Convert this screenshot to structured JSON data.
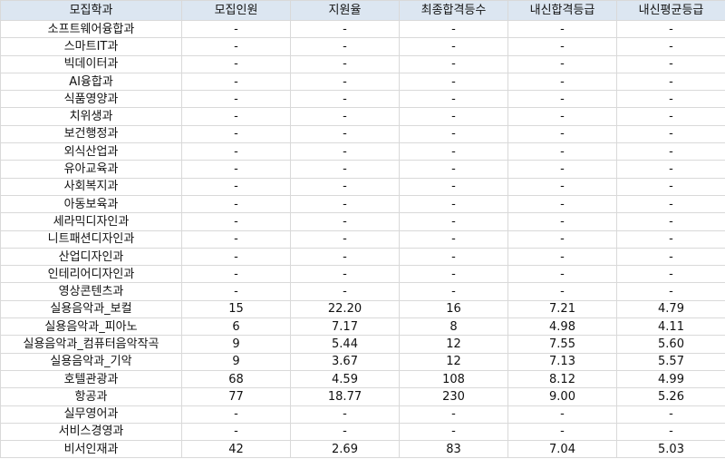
{
  "table": {
    "headers": [
      "모집학과",
      "모집인원",
      "지원율",
      "최종합격등수",
      "내신합격등급",
      "내신평균등급"
    ],
    "rows": [
      [
        "소프트웨어융합과",
        "-",
        "-",
        "-",
        "-",
        "-"
      ],
      [
        "스마트IT과",
        "-",
        "-",
        "-",
        "-",
        "-"
      ],
      [
        "빅데이터과",
        "-",
        "-",
        "-",
        "-",
        "-"
      ],
      [
        "AI융합과",
        "-",
        "-",
        "-",
        "-",
        "-"
      ],
      [
        "식품영양과",
        "-",
        "-",
        "-",
        "-",
        "-"
      ],
      [
        "치위생과",
        "-",
        "-",
        "-",
        "-",
        "-"
      ],
      [
        "보건행정과",
        "-",
        "-",
        "-",
        "-",
        "-"
      ],
      [
        "외식산업과",
        "-",
        "-",
        "-",
        "-",
        "-"
      ],
      [
        "유아교육과",
        "-",
        "-",
        "-",
        "-",
        "-"
      ],
      [
        "사회복지과",
        "-",
        "-",
        "-",
        "-",
        "-"
      ],
      [
        "아동보육과",
        "-",
        "-",
        "-",
        "-",
        "-"
      ],
      [
        "세라믹디자인과",
        "-",
        "-",
        "-",
        "-",
        "-"
      ],
      [
        "니트패션디자인과",
        "-",
        "-",
        "-",
        "-",
        "-"
      ],
      [
        "산업디자인과",
        "-",
        "-",
        "-",
        "-",
        "-"
      ],
      [
        "인테리어디자인과",
        "-",
        "-",
        "-",
        "-",
        "-"
      ],
      [
        "영상콘텐츠과",
        "-",
        "-",
        "-",
        "-",
        "-"
      ],
      [
        "실용음악과_보컬",
        "15",
        "22.20",
        "16",
        "7.21",
        "4.79"
      ],
      [
        "실용음악과_피아노",
        "6",
        "7.17",
        "8",
        "4.98",
        "4.11"
      ],
      [
        "실용음악과_컴퓨터음악작곡",
        "9",
        "5.44",
        "12",
        "7.55",
        "5.60"
      ],
      [
        "실용음악과_기악",
        "9",
        "3.67",
        "12",
        "7.13",
        "5.57"
      ],
      [
        "호텔관광과",
        "68",
        "4.59",
        "108",
        "8.12",
        "4.99"
      ],
      [
        "항공과",
        "77",
        "18.77",
        "230",
        "9.00",
        "5.26"
      ],
      [
        "실무영어과",
        "-",
        "-",
        "-",
        "-",
        "-"
      ],
      [
        "서비스경영과",
        "-",
        "-",
        "-",
        "-",
        "-"
      ],
      [
        "비서인재과",
        "42",
        "2.69",
        "83",
        "7.04",
        "5.03"
      ]
    ]
  }
}
